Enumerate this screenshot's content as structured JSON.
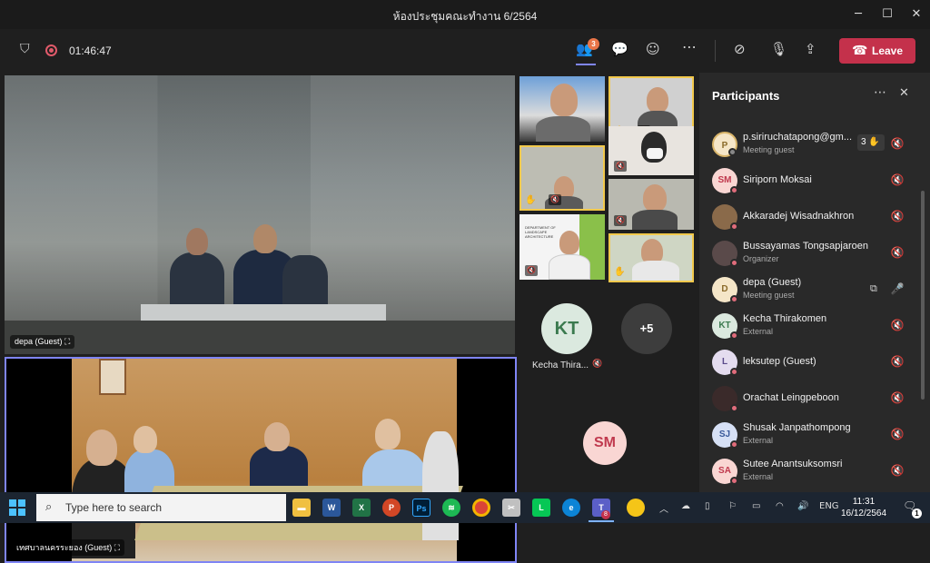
{
  "window": {
    "title": "ห้องประชุมคณะทำงาน 6/2564"
  },
  "toolbar": {
    "timer": "01:46:47",
    "participants_badge": "3",
    "leave_label": "Leave"
  },
  "stage": {
    "main_video_label": "depa (Guest)",
    "second_video_label": "เทศบาลนครระยอง (Guest)",
    "tiles": [
      {
        "initials": "KT",
        "name": "Kecha Thira...",
        "color": "#dbe9df"
      },
      {
        "initials": "+5",
        "name": "",
        "color": "#3d3d3d"
      },
      {
        "initials": "SM",
        "name": "",
        "color": "#f9d6d3"
      }
    ],
    "thumb_text": "DEPARTMENT OF LANDSCAPE ARCHITECTURE"
  },
  "panel": {
    "title": "Participants",
    "participants": [
      {
        "initials": "P",
        "name": "p.siriruchatapong@gm...",
        "sub": "Meeting guest",
        "color": "#f5e6c8",
        "status": "#e06c7b",
        "hand_count": "3",
        "mic": "off"
      },
      {
        "initials": "SM",
        "name": "Siriporn Moksai",
        "sub": "",
        "color": "#f9d6d3",
        "status": "#e06c7b",
        "mic": "off"
      },
      {
        "initials": "",
        "name": "Akkaradej Wisadnakhron",
        "sub": "",
        "color": "#8a6a4a",
        "status": "#e06c7b",
        "mic": "off"
      },
      {
        "initials": "",
        "name": "Bussayamas Tongsapjaroen",
        "sub": "Organizer",
        "color": "#6a5a5a",
        "status": "#e06c7b",
        "mic": "off"
      },
      {
        "initials": "D",
        "name": "depa (Guest)",
        "sub": "Meeting guest",
        "color": "#f5e6c8",
        "status": "#e06c7b",
        "mic": "on"
      },
      {
        "initials": "KT",
        "name": "Kecha Thirakomen",
        "sub": "External",
        "color": "#dbe9df",
        "status": "#e06c7b",
        "mic": "off"
      },
      {
        "initials": "L",
        "name": "leksutep (Guest)",
        "sub": "",
        "color": "#e4dcef",
        "status": "#e06c7b",
        "mic": "off"
      },
      {
        "initials": "",
        "name": "Orachat Leingpeboon",
        "sub": "",
        "color": "#4a3a3a",
        "status": "#e06c7b",
        "mic": "off"
      },
      {
        "initials": "SJ",
        "name": "Shusak Janpathompong",
        "sub": "External",
        "color": "#d6e0f5",
        "status": "#e06c7b",
        "mic": "off"
      },
      {
        "initials": "SA",
        "name": "Sutee Anantsuksomsri",
        "sub": "External",
        "color": "#f9d6d3",
        "status": "#e06c7b",
        "mic": "off"
      }
    ]
  },
  "taskbar": {
    "search_placeholder": "Type here to search",
    "lang": "ENG",
    "time": "11:31",
    "date": "16/12/2564",
    "notification_count": "1",
    "teams_badge": "8"
  }
}
